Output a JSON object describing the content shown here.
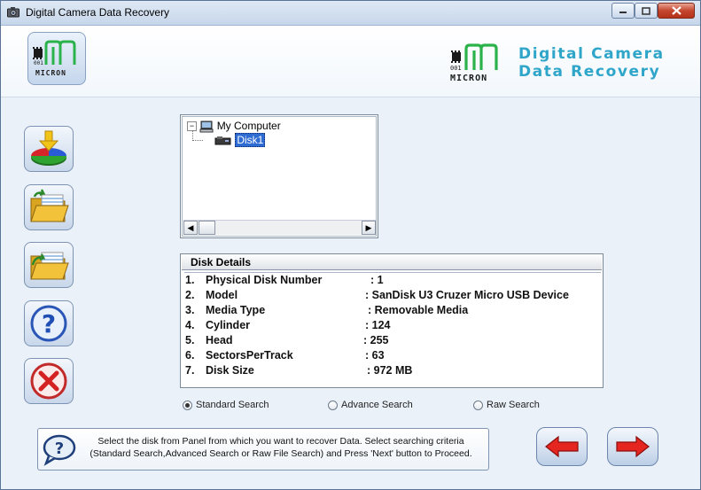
{
  "window": {
    "title": "Digital Camera Data Recovery",
    "close_glyph": "✕",
    "minimize_glyph": "▁",
    "maximize_glyph": "☐"
  },
  "header": {
    "logo_text": "MICRON",
    "logo_digits": "001",
    "brand_line1": "Digital Camera",
    "brand_line2": "Data Recovery",
    "brand_color": "#2fa6c9"
  },
  "sidebar": {
    "buttons": [
      {
        "name": "disk-recovery-button",
        "icon": "disk-pie-download-icon"
      },
      {
        "name": "open-folder-button",
        "icon": "folder-open-icon"
      },
      {
        "name": "save-folder-button",
        "icon": "folder-export-icon"
      },
      {
        "name": "help-button",
        "icon": "question-icon"
      },
      {
        "name": "exit-button",
        "icon": "red-x-icon"
      }
    ]
  },
  "tree": {
    "root": {
      "label": "My Computer",
      "expander": "⊟"
    },
    "child": {
      "label": "Disk1"
    }
  },
  "details": {
    "heading": "Disk Details",
    "rows": [
      {
        "num": "1.",
        "key": "Physical Disk Number",
        "val": ": 1"
      },
      {
        "num": "2.",
        "key": "Model",
        "val": ": SanDisk U3 Cruzer Micro USB Device"
      },
      {
        "num": "3.",
        "key": "Media Type",
        "val": ": Removable Media"
      },
      {
        "num": "4.",
        "key": "Cylinder",
        "val": ": 124"
      },
      {
        "num": "5.",
        "key": "Head",
        "val": ": 255"
      },
      {
        "num": "6.",
        "key": "SectorsPerTrack",
        "val": ": 63"
      },
      {
        "num": "7.",
        "key": "Disk Size",
        "val": ": 972 MB"
      }
    ]
  },
  "search": {
    "options": [
      {
        "label": "Standard Search",
        "selected": true
      },
      {
        "label": "Advance Search",
        "selected": false
      },
      {
        "label": "Raw Search",
        "selected": false
      }
    ]
  },
  "info": {
    "text": "Select the disk from Panel from which you want to recover Data. Select searching criteria (Standard Search,Advanced Search or Raw File Search) and Press 'Next' button to Proceed."
  },
  "nav": {
    "back_icon": "left-arrow-icon",
    "next_icon": "right-arrow-icon"
  }
}
